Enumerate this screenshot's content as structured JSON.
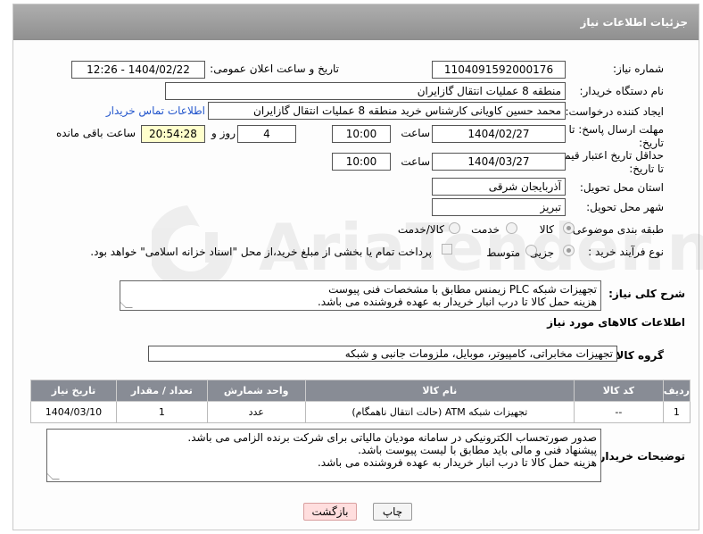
{
  "header": {
    "title": "جزئیات اطلاعات نیاز"
  },
  "fields": {
    "need_number_label": "شماره نیاز:",
    "need_number": "1104091592000176",
    "announce_label": "تاریخ و ساعت اعلان عمومی:",
    "announce_value": "1404/02/22 - 12:26",
    "buyer_org_label": "نام دستگاه خریدار:",
    "buyer_org": "منطقه 8 عملیات انتقال گازایران",
    "creator_label": "ایجاد کننده درخواست:",
    "creator": "محمد حسین کاویانی کارشناس خرید منطقه 8 عملیات انتقال گازایران",
    "contact_link": "اطلاعات تماس خریدار",
    "reply_label_1": "مهلت ارسال پاسخ: تا",
    "reply_label_2": "تاریخ:",
    "reply_date": "1404/02/27",
    "time_label": "ساعت",
    "reply_time": "10:00",
    "days_value": "4",
    "days_label": "روز و",
    "remaining_time": "20:54:28",
    "remaining_label": "ساعت باقی مانده",
    "price_label_1": "حداقل تاریخ اعتبار قیمت:",
    "price_label_2": "تا تاریخ:",
    "price_date": "1404/03/27",
    "price_time": "10:00",
    "province_label": "استان محل تحویل:",
    "province": "آذربایجان شرقی",
    "city_label": "شهر محل تحویل:",
    "city": "تبریز",
    "category_label": "طبقه بندی موضوعی:",
    "category_options": [
      "کالا",
      "خدمت",
      "کالا/خدمت"
    ],
    "process_label": "نوع فرآیند خرید :",
    "process_options": [
      "جزیی",
      "متوسط"
    ],
    "payment_note": "پرداخت تمام یا بخشی از مبلغ خرید،از محل \"اسناد خزانه اسلامی\" خواهد بود."
  },
  "description": {
    "label": "شرح کلی نیاز:",
    "line1": "تجهیزات شبکه PLC زیمنس مطابق با مشخصات فنی پیوست",
    "line2": "هزینه حمل کالا تا درب انبار خریدار به عهده فروشنده می باشد."
  },
  "goods_section": {
    "title": "اطلاعات کالاهای مورد نیاز",
    "group_label": "گروه کالا:",
    "group_value": "تجهیزات مخابراتی، کامپیوتر، موبایل، ملزومات جانبی و شبکه"
  },
  "table": {
    "headers": [
      "ردیف",
      "کد کالا",
      "نام کالا",
      "واحد شمارش",
      "تعداد / مقدار",
      "تاریخ نیاز"
    ],
    "rows": [
      [
        "1",
        "--",
        "تجهیزات شبکه ATM (حالت انتقال ناهمگام)",
        "عدد",
        "1",
        "1404/03/10"
      ]
    ]
  },
  "buyer_notes": {
    "label": "توضیحات خریدار:",
    "line1": "صدور صورتحساب الکترونیکی در سامانه مودیان مالیاتی برای شرکت برنده الزامی می باشد.",
    "line2": "پیشنهاد فنی و مالی باید مطابق با لیست پیوست باشد.",
    "line3": "هزینه حمل کالا تا درب انبار خریدار به عهده فروشنده می باشد."
  },
  "buttons": {
    "print": "چاپ",
    "back": "بازگشت"
  },
  "watermark": {
    "text": "AriaTender.neT"
  }
}
